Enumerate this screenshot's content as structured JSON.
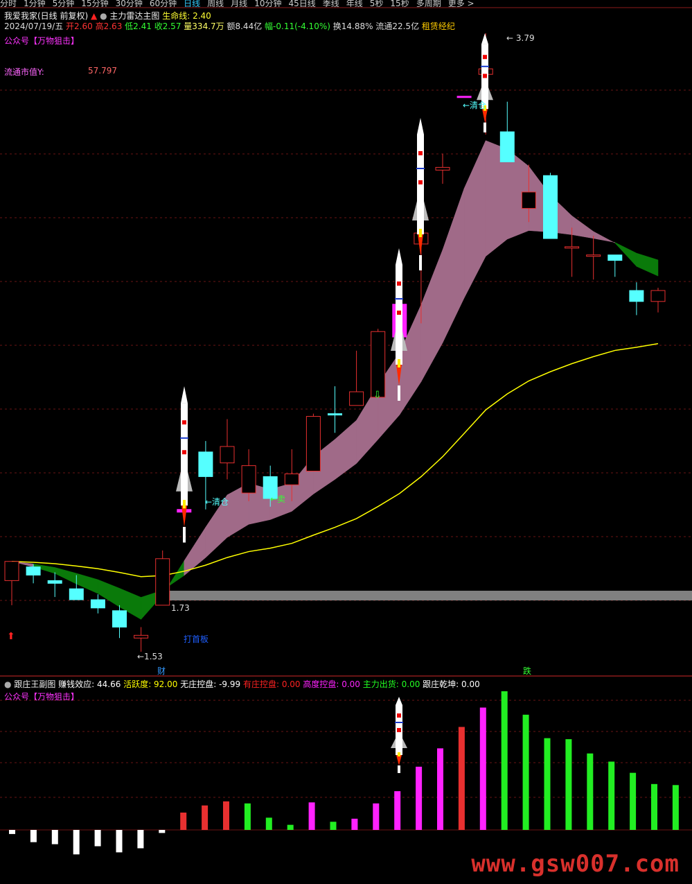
{
  "toolbar": {
    "tabs": [
      "分时",
      "1分钟",
      "5分钟",
      "15分钟",
      "30分钟",
      "60分钟",
      "日线",
      "周线",
      "月线",
      "10分钟",
      "45日线",
      "季线",
      "年线",
      "5秒",
      "15秒",
      "多周期",
      "更多 >"
    ],
    "active_tab": "日线"
  },
  "main_panel": {
    "stock_name": "我爱我家(日线 前复权)",
    "indicator_name": "主力雷达主图",
    "lifeline_label": "生命线: 2.40",
    "quote": {
      "date": "2024/07/19/五",
      "open": "开2.60",
      "high": "高2.63",
      "low": "低2.41",
      "close": "收2.57",
      "volume": "量334.7万",
      "amount": "额8.44亿",
      "change": "幅-0.11(-4.10%)",
      "turnover": "换14.88%",
      "float_cap": "流通22.5亿",
      "concept": "租赁经纪"
    },
    "promo": "公众号【万物狙击】",
    "float_value_label": "流通市值Y:",
    "float_value": "57.797",
    "annotations": {
      "high_price": "3.79",
      "low_price": "1.53",
      "board_price": "1.73",
      "clear1": "清仓",
      "clear2": "清仓",
      "sell": "卖",
      "first_board": "打首板",
      "wealth": "财",
      "fall": "跌"
    }
  },
  "sub_panel": {
    "title": "跟庄王副图",
    "items": [
      {
        "label": "赚钱效应: 44.66",
        "color": "#ffffff"
      },
      {
        "label": "活跃度: 92.00",
        "color": "#ffff00"
      },
      {
        "label": "无庄控盘: -9.99",
        "color": "#ffffff"
      },
      {
        "label": "有庄控盘: 0.00",
        "color": "#ff2222"
      },
      {
        "label": "高度控盘: 0.00",
        "color": "#ff22ff"
      },
      {
        "label": "主力出货: 0.00",
        "color": "#22ff22"
      },
      {
        "label": "跟庄乾坤: 0.00",
        "color": "#ffffff"
      }
    ],
    "promo": "公众号【万物狙击】"
  },
  "watermark": "www.gsw007.com",
  "colors": {
    "up": "#e83030",
    "down": "#55ffff",
    "magenta": "#ff22ff",
    "yellow": "#ffff00",
    "band_up": "#a06a88",
    "band_down": "#0a7a0a",
    "green_bar": "#22ee22"
  },
  "chart_data": [
    {
      "type": "candlestick",
      "title": "主力雷达主图",
      "candles": [
        {
          "o": 1.79,
          "h": 1.84,
          "l": 1.7,
          "c": 1.86,
          "color": "up"
        },
        {
          "o": 1.84,
          "h": 1.85,
          "l": 1.78,
          "c": 1.81,
          "color": "down"
        },
        {
          "o": 1.79,
          "h": 1.82,
          "l": 1.73,
          "c": 1.78,
          "color": "down"
        },
        {
          "o": 1.76,
          "h": 1.81,
          "l": 1.72,
          "c": 1.72,
          "color": "down"
        },
        {
          "o": 1.72,
          "h": 1.74,
          "l": 1.67,
          "c": 1.69,
          "color": "down"
        },
        {
          "o": 1.68,
          "h": 1.7,
          "l": 1.58,
          "c": 1.62,
          "color": "down"
        },
        {
          "o": 1.59,
          "h": 1.62,
          "l": 1.53,
          "c": 1.58,
          "color": "up"
        },
        {
          "o": 1.7,
          "h": 1.9,
          "l": 1.7,
          "c": 1.87,
          "color": "up"
        },
        {
          "o": 2.04,
          "h": 2.05,
          "l": 2.04,
          "c": 2.05,
          "color": "magenta"
        },
        {
          "o": 2.26,
          "h": 2.3,
          "l": 2.05,
          "c": 2.17,
          "color": "down"
        },
        {
          "o": 2.22,
          "h": 2.38,
          "l": 2.16,
          "c": 2.28,
          "color": "up"
        },
        {
          "o": 2.11,
          "h": 2.27,
          "l": 2.08,
          "c": 2.21,
          "color": "up"
        },
        {
          "o": 2.17,
          "h": 2.21,
          "l": 2.06,
          "c": 2.09,
          "color": "down"
        },
        {
          "o": 2.14,
          "h": 2.27,
          "l": 2.08,
          "c": 2.18,
          "color": "up"
        },
        {
          "o": 2.19,
          "h": 2.4,
          "l": 2.19,
          "c": 2.39,
          "color": "up"
        },
        {
          "o": 2.4,
          "h": 2.5,
          "l": 2.33,
          "c": 2.4,
          "color": "down"
        },
        {
          "o": 2.43,
          "h": 2.63,
          "l": 2.43,
          "c": 2.48,
          "color": "up"
        },
        {
          "o": 2.46,
          "h": 2.71,
          "l": 2.46,
          "c": 2.7,
          "color": "up"
        },
        {
          "o": 2.68,
          "h": 2.8,
          "l": 2.68,
          "c": 2.8,
          "color": "magenta"
        },
        {
          "o": 3.02,
          "h": 3.11,
          "l": 2.73,
          "c": 3.06,
          "color": "up"
        },
        {
          "o": 3.29,
          "h": 3.35,
          "l": 3.24,
          "c": 3.3,
          "color": "up"
        },
        {
          "o": 3.56,
          "h": 3.56,
          "l": 3.56,
          "c": 3.56,
          "color": "magenta"
        },
        {
          "o": 3.64,
          "h": 3.79,
          "l": 3.42,
          "c": 3.66,
          "color": "up"
        },
        {
          "o": 3.43,
          "h": 3.54,
          "l": 3.43,
          "c": 3.32,
          "color": "down"
        },
        {
          "o": 3.15,
          "h": 3.31,
          "l": 3.1,
          "c": 3.21,
          "color": "up"
        },
        {
          "o": 3.27,
          "h": 3.28,
          "l": 3.04,
          "c": 3.04,
          "color": "down"
        },
        {
          "o": 3.01,
          "h": 3.08,
          "l": 2.9,
          "c": 3.01,
          "color": "up"
        },
        {
          "o": 2.98,
          "h": 3.05,
          "l": 2.89,
          "c": 2.98,
          "color": "up"
        },
        {
          "o": 2.98,
          "h": 2.97,
          "l": 2.9,
          "c": 2.96,
          "color": "down"
        },
        {
          "o": 2.85,
          "h": 2.88,
          "l": 2.76,
          "c": 2.81,
          "color": "down"
        },
        {
          "o": 2.81,
          "h": 2.86,
          "l": 2.77,
          "c": 2.85,
          "color": "up"
        }
      ],
      "lifeline_value": 2.4
    },
    {
      "type": "bar",
      "title": "跟庄王副图",
      "values": [
        -4,
        -12,
        -14,
        -24,
        -16,
        -22,
        -18,
        -3,
        17,
        24,
        28,
        26,
        12,
        5,
        27,
        8,
        11,
        26,
        38,
        62,
        80,
        101,
        120,
        136,
        113,
        90,
        89,
        75,
        67,
        56,
        45,
        44,
        46
      ],
      "colors": [
        "white",
        "white",
        "white",
        "white",
        "white",
        "white",
        "white",
        "white",
        "red",
        "red",
        "red",
        "green",
        "green",
        "green",
        "magenta",
        "green",
        "magenta",
        "magenta",
        "magenta",
        "magenta",
        "magenta",
        "red",
        "magenta",
        "green",
        "green",
        "green",
        "green",
        "green",
        "green",
        "green",
        "green",
        "green",
        "red"
      ]
    }
  ]
}
